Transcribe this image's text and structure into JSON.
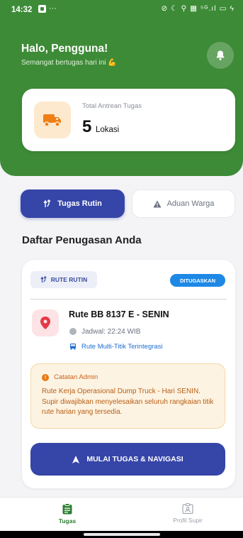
{
  "status_bar": {
    "time": "14:32",
    "dots": "···",
    "right_icons": "⊘ ☾ ⚲ ▦ ⁵ᴳ.ıl ▭ ϟ"
  },
  "header": {
    "greeting": "Halo, Pengguna!",
    "subtitle": "Semangat bertugas hari ini 💪",
    "icons": {
      "notification": "bell-icon"
    },
    "colors": {
      "header_bg": "#3d8b37"
    }
  },
  "summary": {
    "label": "Total Antrean Tugas",
    "value": "5",
    "unit": "Lokasi",
    "icon": "truck-icon"
  },
  "tabs": [
    {
      "label": "Tugas Rutin",
      "active": true,
      "icon": "route-icon"
    },
    {
      "label": "Aduan Warga",
      "active": false,
      "icon": "warning-icon"
    }
  ],
  "section": {
    "title": "Daftar Penugasan Anda"
  },
  "task": {
    "type_label": "RUTE RUTIN",
    "status": "DITUGASKAN",
    "title": "Rute BB 8137 E - SENIN",
    "schedule": "Jadwal: 22:24 WIB",
    "mode": "Rute Multi-Titik Terintegrasi",
    "note": {
      "title": "Catatan Admin",
      "body": "Rute Kerja Operasional Dump Truck - Hari SENIN. Supir diwajibkan menyelesaikan seluruh rangkaian titik rute harian yang tersedia."
    },
    "action_label": "MULAI TUGAS & NAVIGASI",
    "colors": {
      "primary": "#3545a8",
      "status_pill": "#1e88e5",
      "note_bg": "#fdf3e2",
      "note_text": "#b85e16"
    }
  },
  "bottom_nav": [
    {
      "label": "Tugas",
      "active": true,
      "icon": "clipboard-icon"
    },
    {
      "label": "Profil Supir",
      "active": false,
      "icon": "id-card-icon"
    }
  ]
}
